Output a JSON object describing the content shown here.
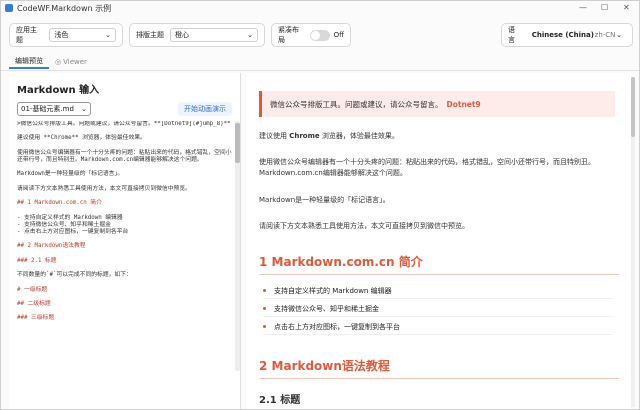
{
  "window": {
    "title": "CodeWF.Markdown 示例"
  },
  "toolbar": {
    "app_theme_label": "应用主题",
    "app_theme_value": "浅色",
    "layout_theme_label": "排版主题",
    "layout_theme_value": "橙心",
    "compact_label": "紧凑布局",
    "compact_value": "Off",
    "language_label": "语言",
    "language_value": "Chinese (China)",
    "language_code": "zh-CN"
  },
  "tabs": [
    "编辑预览",
    "Viewer"
  ],
  "editor": {
    "title": "Markdown 输入",
    "file": "01-基础元素.md",
    "demo_button": "开始动画演示",
    "lines": [
      ">微信公众号排版工具。问题或建议，请公众号留言。**[Dotnet9](#jump_8)**",
      "",
      "建议使用 **Chrome** 浏览器，体验最佳效果。",
      "",
      "使用微信公众号编辑器有一个十分头疼的问题：粘贴出来的代码，格式错乱，空间小还带行号，而且特别丑。Markdown.com.cn编辑器能够解决这个问题。",
      "",
      "Markdown是一种轻量级的「标记语言」。",
      "",
      "请阅读下方文本熟悉工具使用方法，本文可直接拷贝到微信中预览。",
      "",
      "## 1 Markdown.com.cn 简介",
      "",
      "- 支持自定义样式的 Markdown 编辑器",
      "- 支持微信公众号、知乎和稀土掘金",
      "- 点击右上方对应图标，一键复制到各平台",
      "",
      "## 2 Markdown语法教程",
      "",
      "### 2.1 标题",
      "",
      "不同数量的`#`可以完成不同的标题，如下：",
      "",
      "# 一级标题",
      "",
      "## 二级标题",
      "",
      "### 三级标题"
    ]
  },
  "preview": {
    "quote_text": "微信公众号排版工具。问题或建议，请公众号留言。",
    "quote_link": "Dotnet9",
    "p1_pre": "建议使用 ",
    "p1_bold": "Chrome",
    "p1_post": " 浏览器，体验最佳效果。",
    "p2": "使用微信公众号编辑器有一个十分头疼的问题：粘贴出来的代码，格式错乱，空间小还带行号，而且特别丑。Markdown.com.cn编辑器能够解决这个问题。",
    "p3": "Markdown是一种轻量级的「标记语言」。",
    "p4": "请阅读下方文本熟悉工具使用方法，本文可直接拷贝到微信中预览。",
    "h1": "1 Markdown.com.cn 简介",
    "items": [
      "支持自定义样式的 Markdown 编辑器",
      "支持微信公众号、知乎和稀土掘金",
      "点击右上方对应图标，一键复制到各平台"
    ],
    "h2": "2 Markdown语法教程",
    "h3": "2.1 标题"
  }
}
